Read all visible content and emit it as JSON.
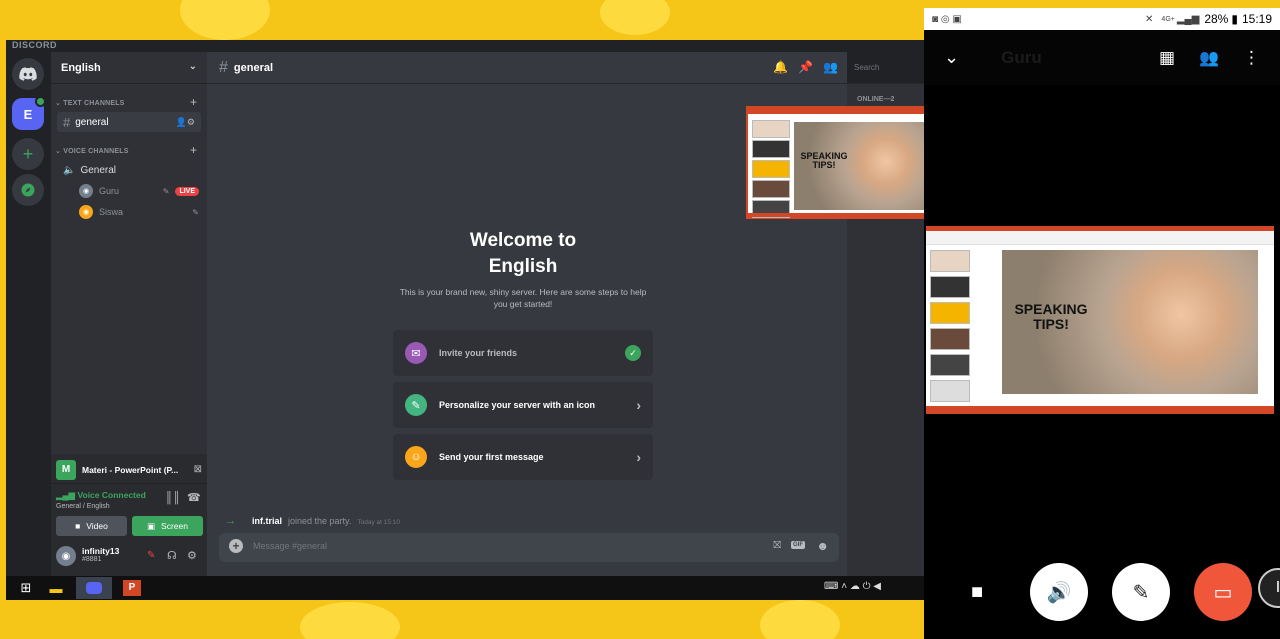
{
  "discord": {
    "brand": "DISCORD",
    "server_name": "English",
    "server_initial": "E",
    "categories": {
      "text": "TEXT CHANNELS",
      "voice": "VOICE CHANNELS"
    },
    "text_channel": "general",
    "voice_channel": "General",
    "voice_users": [
      {
        "name": "Guru",
        "badge": "LIVE"
      },
      {
        "name": "Siswa"
      }
    ],
    "channel_header": "general",
    "search_placeholder": "Search",
    "members_heading": "ONLINE—2",
    "welcome": {
      "title_line1": "Welcome to",
      "title_line2": "English",
      "subtitle_line1": "This is your brand new, shiny server. Here are some steps to help",
      "subtitle_line2": "you get started!",
      "steps": [
        {
          "label": "Invite your friends",
          "done": true
        },
        {
          "label": "Personalize your server with an icon",
          "done": false
        },
        {
          "label": "Send your first message",
          "done": false
        }
      ]
    },
    "system_message": {
      "user": "inf.trial",
      "text": "joined the party.",
      "time": "Today at 15:10"
    },
    "composer_placeholder": "Message #general",
    "activity": {
      "initial": "M",
      "title": "Materi - PowerPoint (P..."
    },
    "voice_status": {
      "title": "Voice Connected",
      "location": "General / English"
    },
    "buttons": {
      "video": "Video",
      "screen": "Screen"
    },
    "user": {
      "name": "infinity13",
      "tag": "#8881"
    }
  },
  "slide": {
    "line1": "SPEAKING",
    "line2": "TIPS!"
  },
  "phone": {
    "status": {
      "network": "4G+",
      "battery": "28%",
      "time": "15:19"
    },
    "call_title": "Guru"
  },
  "colors": {
    "blurple": "#5865f2",
    "green": "#3ba55d",
    "red": "#ed4245",
    "orange": "#f25022"
  }
}
